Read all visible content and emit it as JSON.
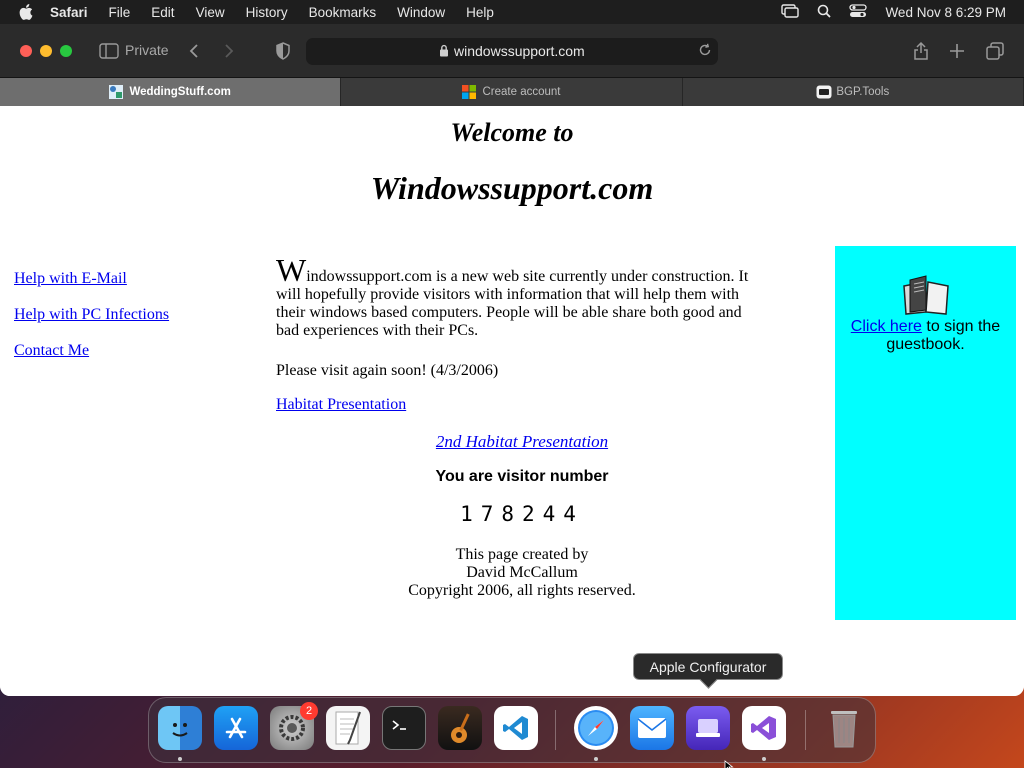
{
  "menubar": {
    "app_name": "Safari",
    "items": [
      "File",
      "Edit",
      "View",
      "History",
      "Bookmarks",
      "Window",
      "Help"
    ],
    "clock": "Wed Nov 8  6:29 PM"
  },
  "browser": {
    "private_label": "Private",
    "url": "windowssupport.com",
    "tabs": [
      {
        "label": "WeddingStuff.com",
        "active": true
      },
      {
        "label": "Create account",
        "active": false
      },
      {
        "label": "BGP.Tools",
        "active": false
      }
    ]
  },
  "page": {
    "welcome": "Welcome to",
    "site_title": "Windowssupport.com",
    "side_links": [
      "Help with E-Mail",
      "Help with PC Infections",
      "Contact Me"
    ],
    "intro_dropcap": "W",
    "intro_text": "indowssupport.com is a new web site currently under construction.  It will hopefully provide visitors with information that will help them with their windows based computers.  People will be able share both good and bad experiences with their PCs.",
    "visit_again": "Please visit again soon!  (4/3/2006)",
    "habitat_link": "Habitat Presentation",
    "habitat2_link": "2nd Habitat Presentation",
    "visitor_label": "You are visitor number",
    "visitor_count": "178244",
    "credits": [
      "This page created by",
      "David McCallum",
      "Copyright 2006, all rights reserved."
    ],
    "guestbook_link": "Click here",
    "guestbook_text": " to sign the guestbook."
  },
  "dock": {
    "tooltip": "Apple Configurator",
    "settings_badge": "2",
    "apps": [
      "finder-icon",
      "app-store-icon",
      "system-settings-icon",
      "textedit-icon",
      "terminal-icon",
      "garageband-icon",
      "vscode-icon",
      "safari-icon",
      "mail-icon",
      "apple-configurator-icon",
      "visual-studio-icon",
      "trash-icon"
    ]
  },
  "colors": {
    "link": "#0000ee",
    "guestbook_panel": "#00ffff"
  }
}
